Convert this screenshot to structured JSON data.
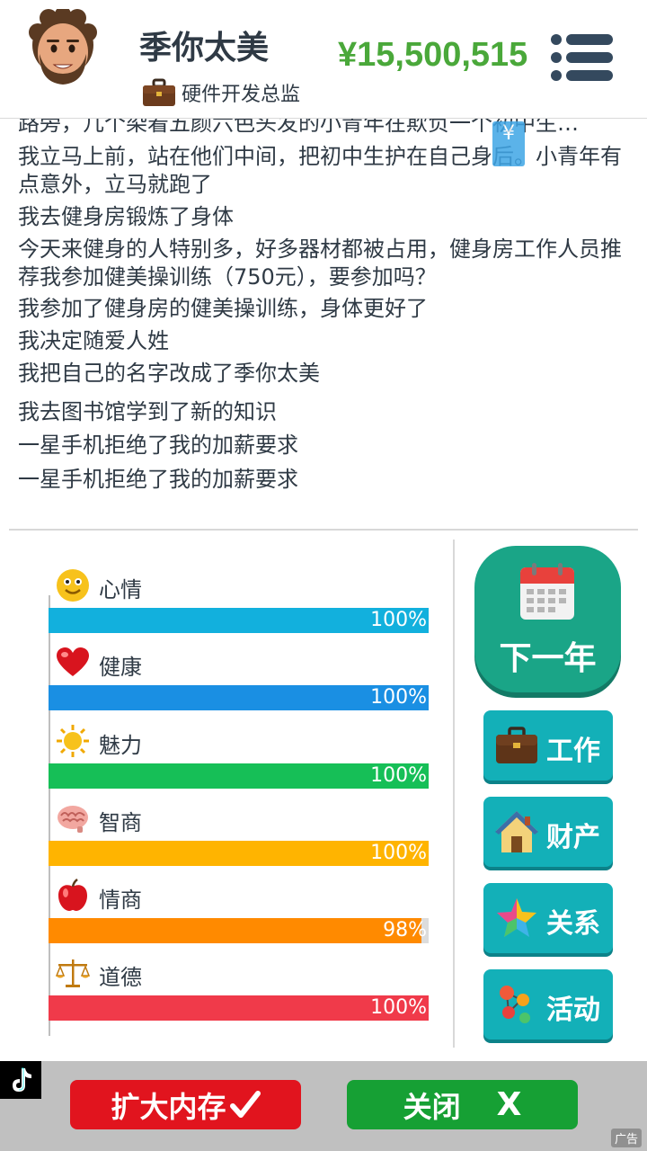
{
  "header": {
    "player_name": "季你太美",
    "job_title": "硬件开发总监",
    "money": "¥15,500,515"
  },
  "log": {
    "cut_line": "路旁，几个染着五颜六色头发的小青年在欺负一个初中生…",
    "lines": [
      "我立马上前，站在他们中间，把初中生护在自己身后。小青年有点意外，立马就跑了",
      "我去健身房锻炼了身体",
      "今天来健身的人特别多，好多器材都被占用，健身房工作人员推荐我参加健美操训练（750元），要参加吗？",
      "我参加了健身房的健美操训练，身体更好了",
      "我决定随爱人姓",
      "我把自己的名字改成了季你太美",
      "我去图书馆学到了新的知识",
      "一星手机拒绝了我的加薪要求",
      "一星手机拒绝了我的加薪要求"
    ],
    "badge": "¥"
  },
  "stats": [
    {
      "label": "心情",
      "value": 100,
      "value_text": "100%",
      "color": "#12b0dd",
      "icon": "smiley-icon"
    },
    {
      "label": "健康",
      "value": 100,
      "value_text": "100%",
      "color": "#1a8fe3",
      "icon": "heart-icon"
    },
    {
      "label": "魅力",
      "value": 100,
      "value_text": "100%",
      "color": "#16bf57",
      "icon": "sun-icon"
    },
    {
      "label": "智商",
      "value": 100,
      "value_text": "100%",
      "color": "#ffb400",
      "icon": "brain-icon"
    },
    {
      "label": "情商",
      "value": 98,
      "value_text": "98%",
      "color": "#ff8a00",
      "icon": "apple-icon"
    },
    {
      "label": "道德",
      "value": 100,
      "value_text": "100%",
      "color": "#f03a4a",
      "icon": "scale-icon"
    }
  ],
  "actions": {
    "next_year": "下一年",
    "work": "工作",
    "assets": "财产",
    "relations": "关系",
    "activities": "活动"
  },
  "ad": {
    "expand_label": "扩大内存",
    "close_label": "关闭",
    "close_x": "X",
    "tag": "广告"
  },
  "colors": {
    "money_green": "#4aa83a",
    "primary_button": "#1aa587",
    "side_button": "#13b0b8"
  }
}
